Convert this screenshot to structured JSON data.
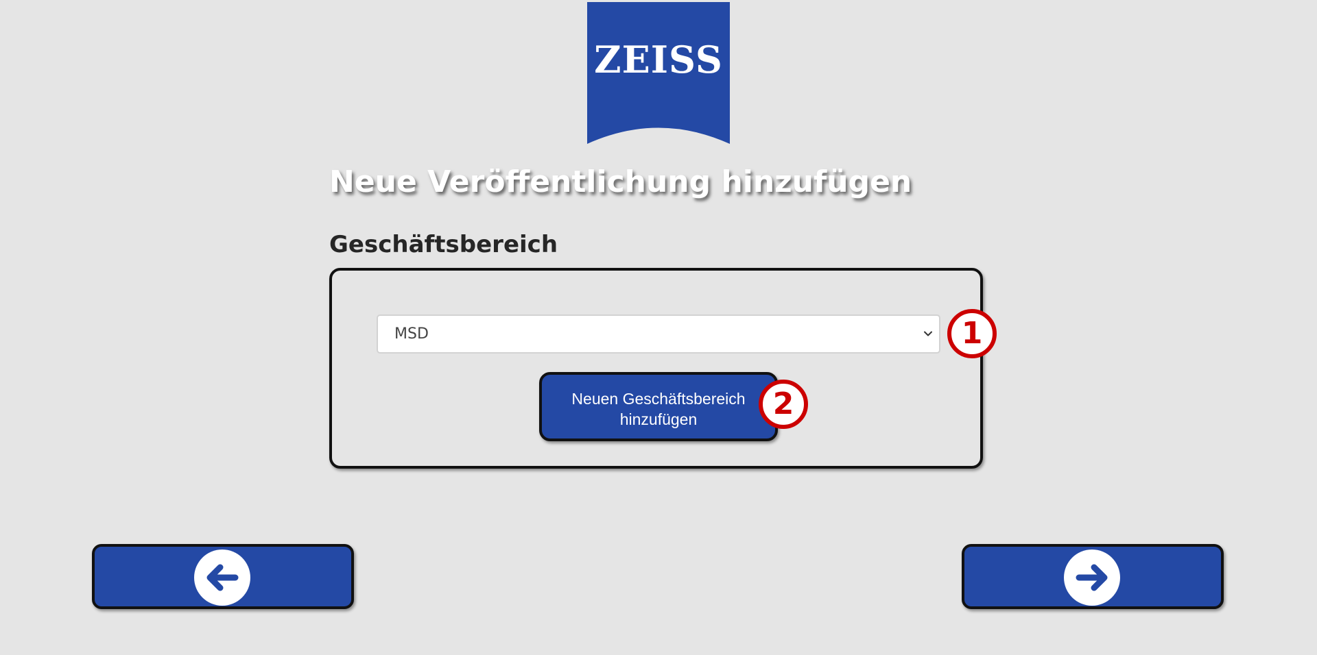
{
  "brand": {
    "logo_text": "ZEISS",
    "color": "#2449a5"
  },
  "page": {
    "title": "Neue Veröffentlichung hinzufügen"
  },
  "business_area": {
    "label": "Geschäftsbereich",
    "selected_value": "MSD",
    "add_button_line1": "Neuen Geschäftsbereich",
    "add_button_line2": "hinzufügen"
  },
  "annotations": {
    "marker_1": "1",
    "marker_2": "2",
    "color": "#cc0000"
  },
  "navigation": {
    "back_icon": "arrow-left-icon",
    "next_icon": "arrow-right-icon"
  }
}
